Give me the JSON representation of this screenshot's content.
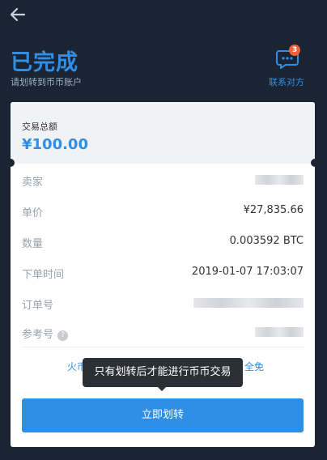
{
  "header": {
    "title": "已完成",
    "subtitle": "请划转到币币账户"
  },
  "contact": {
    "label": "联系对方",
    "badge": "3"
  },
  "summary": {
    "label": "交易总额",
    "amount": "¥100.00"
  },
  "details": [
    {
      "key": "卖家",
      "value": ""
    },
    {
      "key": "单价",
      "value": "¥27,835.66"
    },
    {
      "key": "数量",
      "value": "0.003592 BTC"
    },
    {
      "key": "下单时间",
      "value": "2019-01-07 17:03:07"
    },
    {
      "key": "订单号",
      "value": ""
    },
    {
      "key": "参考号",
      "value": ""
    }
  ],
  "notice": {
    "left_fragment": "火币",
    "right_fragment": "全免"
  },
  "tooltip": "只有划转后才能进行币币交易",
  "transfer_button": "立即划转",
  "colors": {
    "accent": "#2f8ee5",
    "background": "#1b2433",
    "badge": "#f0603a"
  }
}
